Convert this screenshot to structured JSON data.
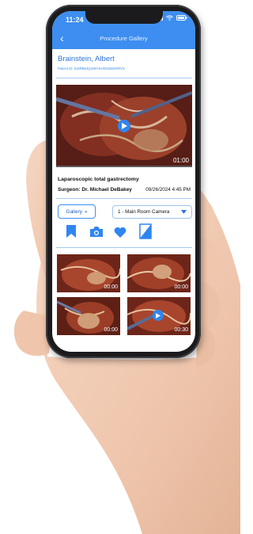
{
  "status": {
    "time": "11:24"
  },
  "nav": {
    "title": "Procedure Gallery"
  },
  "patient": {
    "name": "Brainstein, Albert",
    "id_label": "Patient ID: 018RB64QX89YKHD018KNRRVS"
  },
  "main_video": {
    "duration": "01:00",
    "procedure": "Laparoscopic total gastrectomy",
    "surgeon": "Surgeon: Dr. Michael DeBakey",
    "datetime": "09/26/2024 4:45 PM"
  },
  "controls": {
    "gallery_label": "Gallery",
    "camera_value": "1 - Main Room Camera"
  },
  "actions": [
    "bookmark-icon",
    "camera-icon",
    "heart-icon",
    "mirror-icon"
  ],
  "thumbnails": [
    {
      "duration": "00:00"
    },
    {
      "duration": "00:00"
    },
    {
      "duration": "00:00"
    },
    {
      "duration": "00:30"
    }
  ],
  "colors": {
    "accent": "#3d8ef0",
    "tissue": "#7a2a1e"
  }
}
